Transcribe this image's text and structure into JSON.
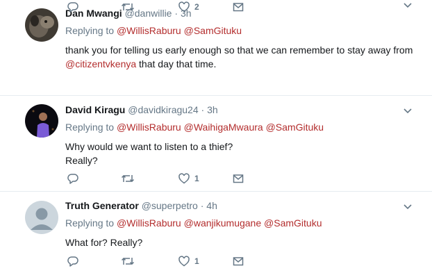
{
  "tweets": [
    {
      "name": "Dan Mwangi",
      "handle": "@danwillie",
      "separator": "·",
      "time": "3h",
      "replying_prefix": "Replying to",
      "mentions": [
        "@WillisRaburu",
        "@SamGituku"
      ],
      "body_line1": "thank you for telling us early enough so that we can remember to stay away from",
      "body_mention": "@citizentvkenya",
      "body_line2_rest": " that day that time.",
      "like_count": "2",
      "avatar_colors": {
        "bg": "#3f3a33",
        "fg": "#8a7f70"
      }
    },
    {
      "name": "David Kiragu",
      "handle": "@davidkiragu24",
      "separator": "·",
      "time": "3h",
      "replying_prefix": "Replying to",
      "mentions": [
        "@WillisRaburu",
        "@WaihigaMwaura",
        "@SamGituku"
      ],
      "body_line1": "Why would we want to listen to a thief?",
      "body_line2": "Really?",
      "like_count": "1",
      "avatar_colors": {
        "bg": "#0b0a10",
        "fg": "#7a5bd6"
      }
    },
    {
      "name": "Truth Generator",
      "handle": "@superpetro",
      "separator": "·",
      "time": "4h",
      "replying_prefix": "Replying to",
      "mentions": [
        "@WillisRaburu",
        "@wanjikumugane",
        "@SamGituku"
      ],
      "body_line1": "What for? Really?",
      "like_count": "1",
      "avatar_colors": {
        "bg": "#ccd6dd",
        "fg": "#8899a6"
      }
    }
  ],
  "icons": {
    "reply": "reply-icon",
    "retweet": "retweet-icon",
    "like": "heart-icon",
    "dm": "envelope-icon",
    "more": "chevron-down-icon"
  },
  "colors": {
    "mention": "#b32d2d",
    "muted": "#657786",
    "text": "#14171a",
    "divider": "#e6ecf0"
  }
}
